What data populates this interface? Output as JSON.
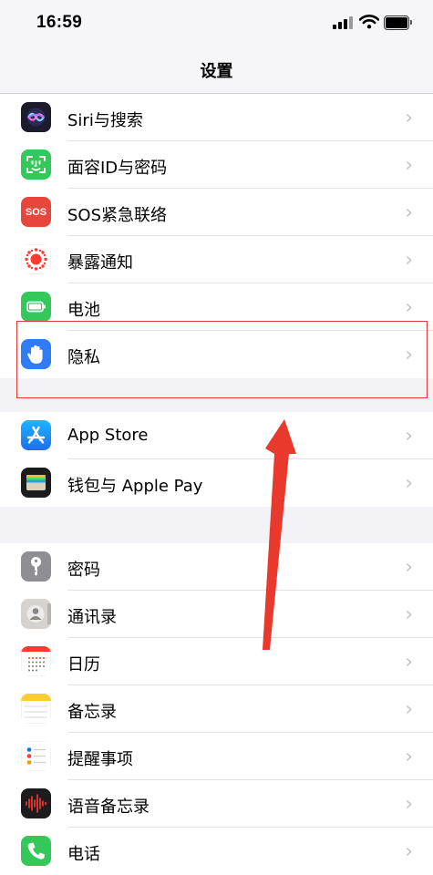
{
  "status_bar": {
    "time": "16:59"
  },
  "nav": {
    "title": "设置"
  },
  "groups": [
    [
      {
        "label": "Siri与搜索",
        "icon": "siri-icon"
      },
      {
        "label": "面容ID与密码",
        "icon": "face-id-icon"
      },
      {
        "label": "SOS紧急联络",
        "icon": "sos-icon",
        "icon_text": "SOS"
      },
      {
        "label": "暴露通知",
        "icon": "exposure-notification-icon"
      },
      {
        "label": "电池",
        "icon": "battery-icon"
      },
      {
        "label": "隐私",
        "icon": "privacy-hand-icon"
      }
    ],
    [
      {
        "label": "App Store",
        "icon": "app-store-icon"
      },
      {
        "label": "钱包与 Apple Pay",
        "icon": "wallet-icon"
      }
    ],
    [
      {
        "label": "密码",
        "icon": "key-icon"
      },
      {
        "label": "通讯录",
        "icon": "contacts-icon"
      },
      {
        "label": "日历",
        "icon": "calendar-icon"
      },
      {
        "label": "备忘录",
        "icon": "notes-icon"
      },
      {
        "label": "提醒事项",
        "icon": "reminders-icon"
      },
      {
        "label": "语音备忘录",
        "icon": "voice-memos-icon"
      },
      {
        "label": "电话",
        "icon": "phone-icon"
      }
    ]
  ],
  "colors": {
    "highlight": "#e23a3a",
    "arrow": "#e8392c",
    "chevron": "#c4c4c8",
    "background": "#f2f2f7"
  }
}
